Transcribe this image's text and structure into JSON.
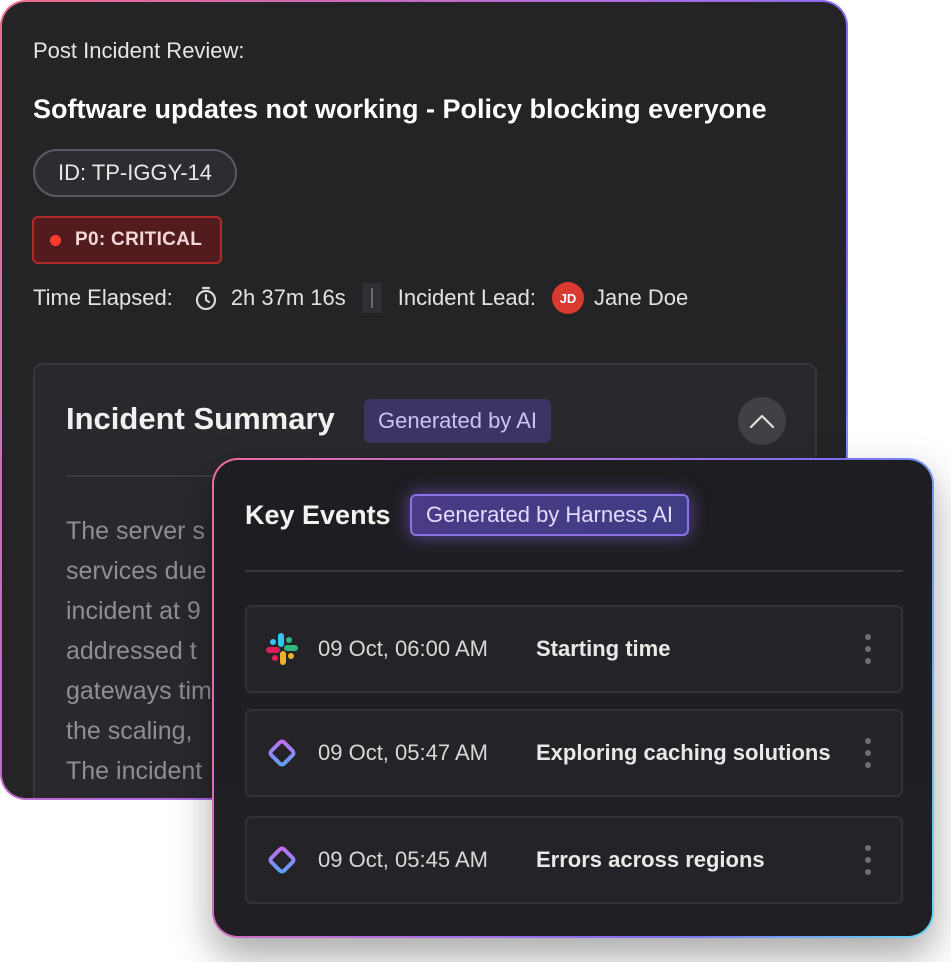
{
  "review": {
    "label": "Post Incident Review:",
    "title": "Software updates not working - Policy blocking everyone",
    "id": "ID: TP-IGGY-14",
    "priority": "P0: CRITICAL",
    "time_elapsed_label": "Time Elapsed:",
    "time_elapsed_value": "2h 37m 16s",
    "incident_lead_label": "Incident Lead:",
    "lead_initials": "JD",
    "lead_name": "Jane Doe",
    "colors": {
      "critical": "#ff3b30",
      "avatar": "#d93a2f"
    }
  },
  "summary": {
    "title": "Incident Summary",
    "badge": "Generated by AI",
    "lines": [
      "The server s",
      "services due",
      "incident at 9",
      "addressed t",
      "gateways tim",
      "the scaling,",
      "The incident"
    ]
  },
  "key_events": {
    "title": "Key Events",
    "badge": "Generated by Harness AI",
    "items": [
      {
        "icon": "slack-icon",
        "time": "09 Oct, 06:00 AM",
        "label": "Starting time"
      },
      {
        "icon": "harness-icon",
        "time": "09 Oct, 05:47 AM",
        "label": "Exploring caching solutions"
      },
      {
        "icon": "harness-icon",
        "time": "09 Oct, 05:45 AM",
        "label": "Errors across regions"
      }
    ]
  }
}
